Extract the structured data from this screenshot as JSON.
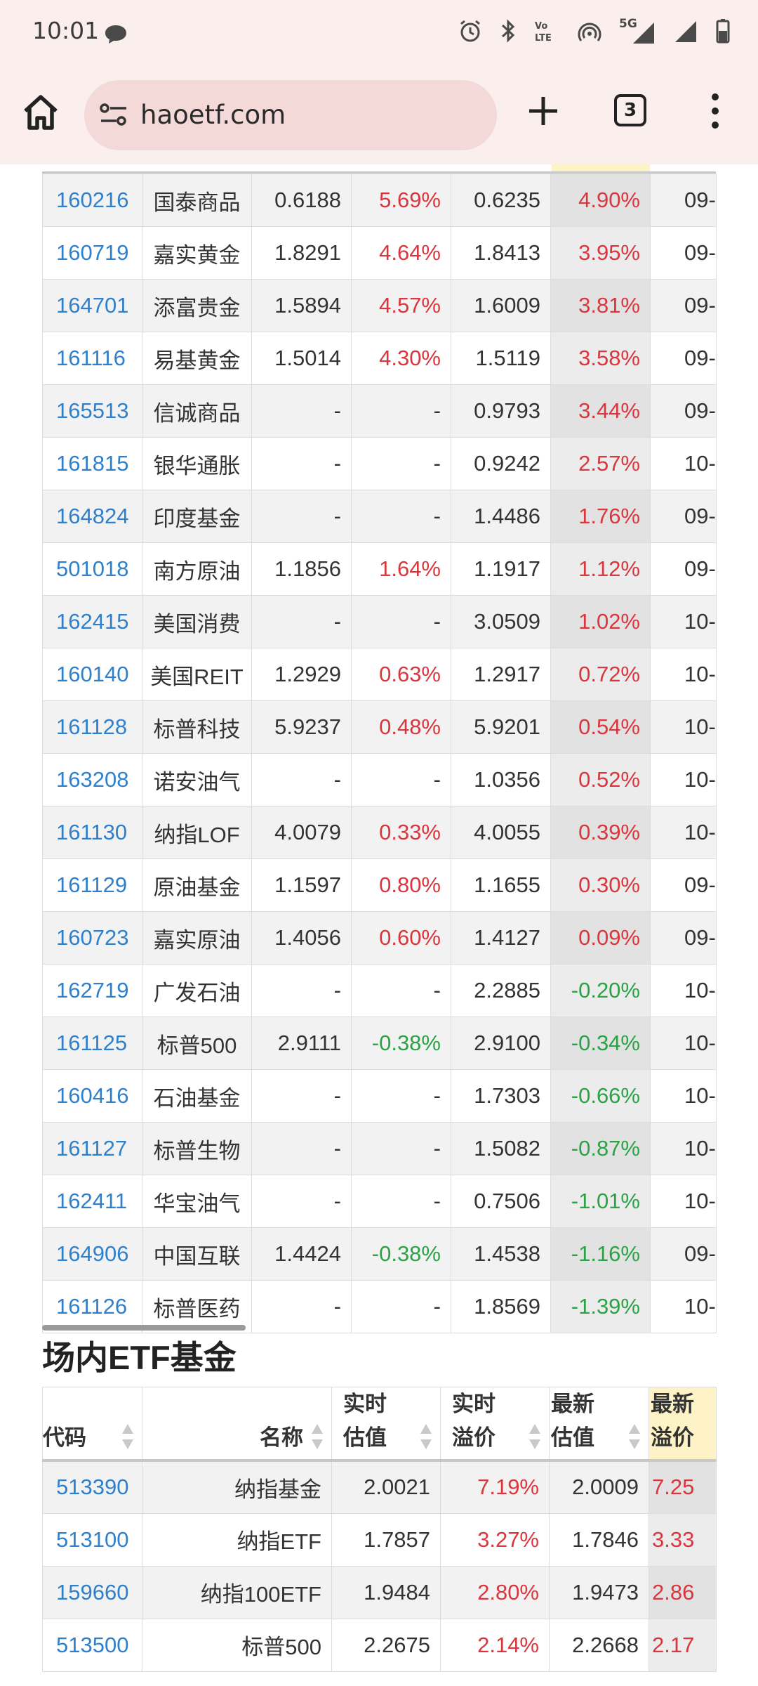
{
  "status_bar": {
    "time": "10:01",
    "network": "5G",
    "volte": "VoLTE"
  },
  "browser": {
    "url": "haoetf.com",
    "tab_count": "3"
  },
  "lof_table": {
    "rows": [
      {
        "code": "160216",
        "name": "国泰商品",
        "rt_nav": "0.6188",
        "rt_prem": "5.69%",
        "rt_prem_dir": "pos",
        "latest_nav": "0.6235",
        "latest_prem": "4.90%",
        "latest_prem_dir": "pos",
        "date": "09-"
      },
      {
        "code": "160719",
        "name": "嘉实黄金",
        "rt_nav": "1.8291",
        "rt_prem": "4.64%",
        "rt_prem_dir": "pos",
        "latest_nav": "1.8413",
        "latest_prem": "3.95%",
        "latest_prem_dir": "pos",
        "date": "09-"
      },
      {
        "code": "164701",
        "name": "添富贵金",
        "rt_nav": "1.5894",
        "rt_prem": "4.57%",
        "rt_prem_dir": "pos",
        "latest_nav": "1.6009",
        "latest_prem": "3.81%",
        "latest_prem_dir": "pos",
        "date": "09-"
      },
      {
        "code": "161116",
        "name": "易基黄金",
        "rt_nav": "1.5014",
        "rt_prem": "4.30%",
        "rt_prem_dir": "pos",
        "latest_nav": "1.5119",
        "latest_prem": "3.58%",
        "latest_prem_dir": "pos",
        "date": "09-"
      },
      {
        "code": "165513",
        "name": "信诚商品",
        "rt_nav": "-",
        "rt_prem": "-",
        "rt_prem_dir": "num",
        "latest_nav": "0.9793",
        "latest_prem": "3.44%",
        "latest_prem_dir": "pos",
        "date": "09-"
      },
      {
        "code": "161815",
        "name": "银华通胀",
        "rt_nav": "-",
        "rt_prem": "-",
        "rt_prem_dir": "num",
        "latest_nav": "0.9242",
        "latest_prem": "2.57%",
        "latest_prem_dir": "pos",
        "date": "10-"
      },
      {
        "code": "164824",
        "name": "印度基金",
        "rt_nav": "-",
        "rt_prem": "-",
        "rt_prem_dir": "num",
        "latest_nav": "1.4486",
        "latest_prem": "1.76%",
        "latest_prem_dir": "pos",
        "date": "09-"
      },
      {
        "code": "501018",
        "name": "南方原油",
        "rt_nav": "1.1856",
        "rt_prem": "1.64%",
        "rt_prem_dir": "pos",
        "latest_nav": "1.1917",
        "latest_prem": "1.12%",
        "latest_prem_dir": "pos",
        "date": "09-"
      },
      {
        "code": "162415",
        "name": "美国消费",
        "rt_nav": "-",
        "rt_prem": "-",
        "rt_prem_dir": "num",
        "latest_nav": "3.0509",
        "latest_prem": "1.02%",
        "latest_prem_dir": "pos",
        "date": "10-"
      },
      {
        "code": "160140",
        "name": "美国REIT",
        "rt_nav": "1.2929",
        "rt_prem": "0.63%",
        "rt_prem_dir": "pos",
        "latest_nav": "1.2917",
        "latest_prem": "0.72%",
        "latest_prem_dir": "pos",
        "date": "10-"
      },
      {
        "code": "161128",
        "name": "标普科技",
        "rt_nav": "5.9237",
        "rt_prem": "0.48%",
        "rt_prem_dir": "pos",
        "latest_nav": "5.9201",
        "latest_prem": "0.54%",
        "latest_prem_dir": "pos",
        "date": "10-"
      },
      {
        "code": "163208",
        "name": "诺安油气",
        "rt_nav": "-",
        "rt_prem": "-",
        "rt_prem_dir": "num",
        "latest_nav": "1.0356",
        "latest_prem": "0.52%",
        "latest_prem_dir": "pos",
        "date": "10-"
      },
      {
        "code": "161130",
        "name": "纳指LOF",
        "rt_nav": "4.0079",
        "rt_prem": "0.33%",
        "rt_prem_dir": "pos",
        "latest_nav": "4.0055",
        "latest_prem": "0.39%",
        "latest_prem_dir": "pos",
        "date": "10-"
      },
      {
        "code": "161129",
        "name": "原油基金",
        "rt_nav": "1.1597",
        "rt_prem": "0.80%",
        "rt_prem_dir": "pos",
        "latest_nav": "1.1655",
        "latest_prem": "0.30%",
        "latest_prem_dir": "pos",
        "date": "09-"
      },
      {
        "code": "160723",
        "name": "嘉实原油",
        "rt_nav": "1.4056",
        "rt_prem": "0.60%",
        "rt_prem_dir": "pos",
        "latest_nav": "1.4127",
        "latest_prem": "0.09%",
        "latest_prem_dir": "pos",
        "date": "09-"
      },
      {
        "code": "162719",
        "name": "广发石油",
        "rt_nav": "-",
        "rt_prem": "-",
        "rt_prem_dir": "num",
        "latest_nav": "2.2885",
        "latest_prem": "-0.20%",
        "latest_prem_dir": "neg",
        "date": "10-"
      },
      {
        "code": "161125",
        "name": "标普500",
        "rt_nav": "2.9111",
        "rt_prem": "-0.38%",
        "rt_prem_dir": "neg",
        "latest_nav": "2.9100",
        "latest_prem": "-0.34%",
        "latest_prem_dir": "neg",
        "date": "10-"
      },
      {
        "code": "160416",
        "name": "石油基金",
        "rt_nav": "-",
        "rt_prem": "-",
        "rt_prem_dir": "num",
        "latest_nav": "1.7303",
        "latest_prem": "-0.66%",
        "latest_prem_dir": "neg",
        "date": "10-"
      },
      {
        "code": "161127",
        "name": "标普生物",
        "rt_nav": "-",
        "rt_prem": "-",
        "rt_prem_dir": "num",
        "latest_nav": "1.5082",
        "latest_prem": "-0.87%",
        "latest_prem_dir": "neg",
        "date": "10-"
      },
      {
        "code": "162411",
        "name": "华宝油气",
        "rt_nav": "-",
        "rt_prem": "-",
        "rt_prem_dir": "num",
        "latest_nav": "0.7506",
        "latest_prem": "-1.01%",
        "latest_prem_dir": "neg",
        "date": "10-"
      },
      {
        "code": "164906",
        "name": "中国互联",
        "rt_nav": "1.4424",
        "rt_prem": "-0.38%",
        "rt_prem_dir": "neg",
        "latest_nav": "1.4538",
        "latest_prem": "-1.16%",
        "latest_prem_dir": "neg",
        "date": "09-"
      },
      {
        "code": "161126",
        "name": "标普医药",
        "rt_nav": "-",
        "rt_prem": "-",
        "rt_prem_dir": "num",
        "latest_nav": "1.8569",
        "latest_prem": "-1.39%",
        "latest_prem_dir": "neg",
        "date": "10-"
      }
    ]
  },
  "etf_section": {
    "title": "场内ETF基金",
    "headers": {
      "code": "代码",
      "name": "名称",
      "rt_nav_1": "实时",
      "rt_nav_2": "估值",
      "rt_prem_1": "实时",
      "rt_prem_2": "溢价",
      "latest_nav_1": "最新",
      "latest_nav_2": "估值",
      "latest_prem_1": "最新",
      "latest_prem_2": "溢价"
    },
    "rows": [
      {
        "code": "513390",
        "name": "纳指基金",
        "rt_nav": "2.0021",
        "rt_prem": "7.19%",
        "latest_nav": "2.0009",
        "latest_prem": "7.25"
      },
      {
        "code": "513100",
        "name": "纳指ETF",
        "rt_nav": "1.7857",
        "rt_prem": "3.27%",
        "latest_nav": "1.7846",
        "latest_prem": "3.33"
      },
      {
        "code": "159660",
        "name": "纳指100ETF",
        "rt_nav": "1.9484",
        "rt_prem": "2.80%",
        "latest_nav": "1.9473",
        "latest_prem": "2.86"
      },
      {
        "code": "513500",
        "name": "标普500",
        "rt_nav": "2.2675",
        "rt_prem": "2.14%",
        "latest_nav": "2.2668",
        "latest_prem": "2.17"
      }
    ]
  },
  "colors": {
    "link": "#2f80cc",
    "positive": "#d9363e",
    "negative": "#2ba245",
    "header_highlight": "#fdf3c6",
    "chrome_bg": "#fbefee"
  }
}
